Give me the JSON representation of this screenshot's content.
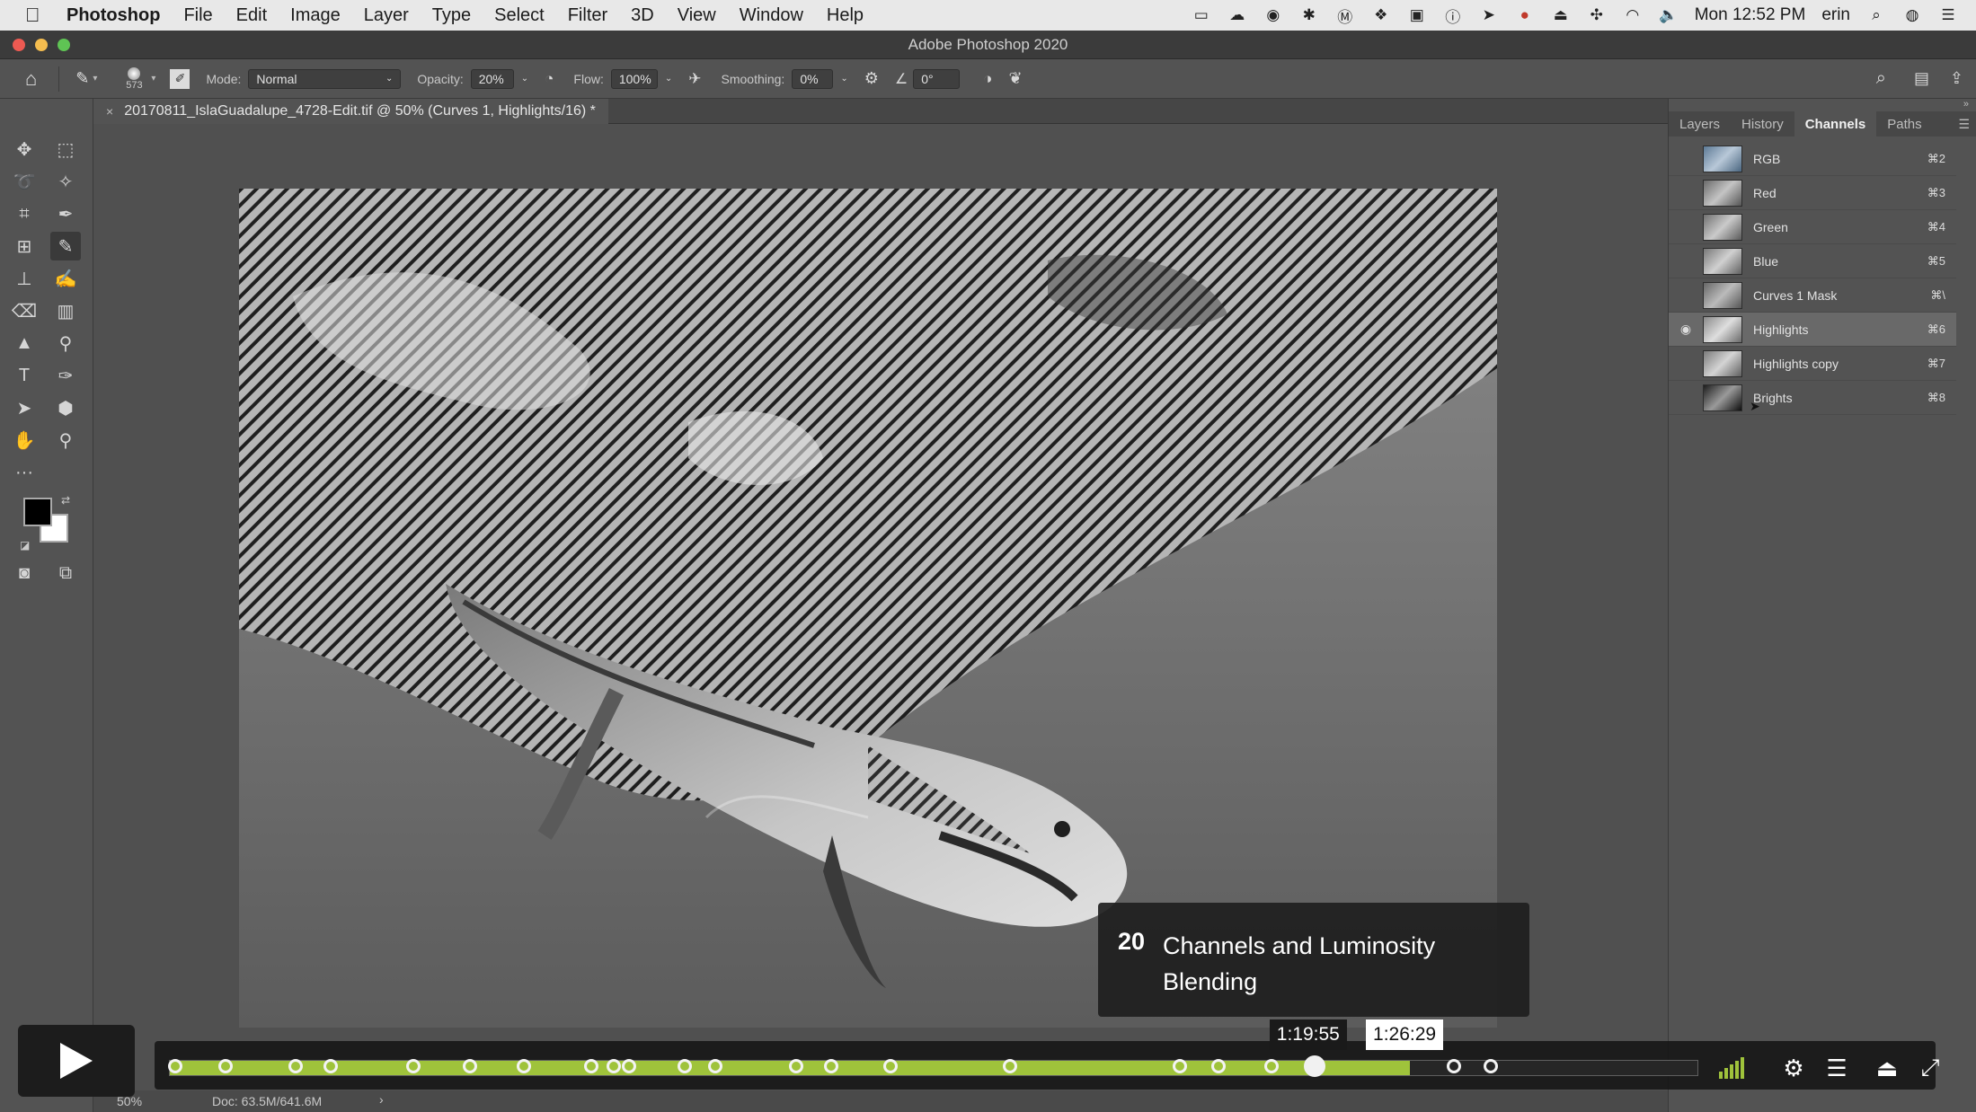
{
  "menubar": {
    "app_name": "Photoshop",
    "items": [
      "File",
      "Edit",
      "Image",
      "Layer",
      "Type",
      "Select",
      "Filter",
      "3D",
      "View",
      "Window",
      "Help"
    ],
    "clock": "Mon 12:52 PM",
    "user": "erin"
  },
  "window": {
    "title": "Adobe Photoshop 2020"
  },
  "options_bar": {
    "brush_size": "573",
    "mode_label": "Mode:",
    "mode_value": "Normal",
    "opacity_label": "Opacity:",
    "opacity_value": "20%",
    "flow_label": "Flow:",
    "flow_value": "100%",
    "smoothing_label": "Smoothing:",
    "smoothing_value": "0%",
    "angle_value": "0°"
  },
  "document": {
    "tab_label": "20170811_IslaGuadalupe_4728-Edit.tif @ 50% (Curves 1, Highlights/16) *",
    "zoom": "50%",
    "doc_size": "Doc: 63.5M/641.6M"
  },
  "panel": {
    "tabs": [
      "Layers",
      "History",
      "Channels",
      "Paths"
    ],
    "active_tab": "Channels",
    "channels": [
      {
        "name": "RGB",
        "shortcut": "⌘2",
        "visible": false
      },
      {
        "name": "Red",
        "shortcut": "⌘3",
        "visible": false
      },
      {
        "name": "Green",
        "shortcut": "⌘4",
        "visible": false
      },
      {
        "name": "Blue",
        "shortcut": "⌘5",
        "visible": false
      },
      {
        "name": "Curves 1 Mask",
        "shortcut": "⌘\\",
        "visible": false
      },
      {
        "name": "Highlights",
        "shortcut": "⌘6",
        "visible": true
      },
      {
        "name": "Highlights copy",
        "shortcut": "⌘7",
        "visible": false
      },
      {
        "name": "Brights",
        "shortcut": "⌘8",
        "visible": false
      }
    ]
  },
  "lesson": {
    "number": "20",
    "title": "Channels and Luminosity Blending"
  },
  "player": {
    "hover_time": "1:19:55",
    "current_time": "1:26:29",
    "progress_fraction": 0.812,
    "playhead_fraction": 0.749,
    "chapter_fractions": [
      0.004,
      0.037,
      0.083,
      0.106,
      0.16,
      0.197,
      0.232,
      0.276,
      0.291,
      0.301,
      0.337,
      0.357,
      0.41,
      0.433,
      0.472,
      0.55,
      0.661,
      0.686,
      0.721,
      0.84,
      0.864
    ],
    "accent_color": "#9fc33b"
  }
}
